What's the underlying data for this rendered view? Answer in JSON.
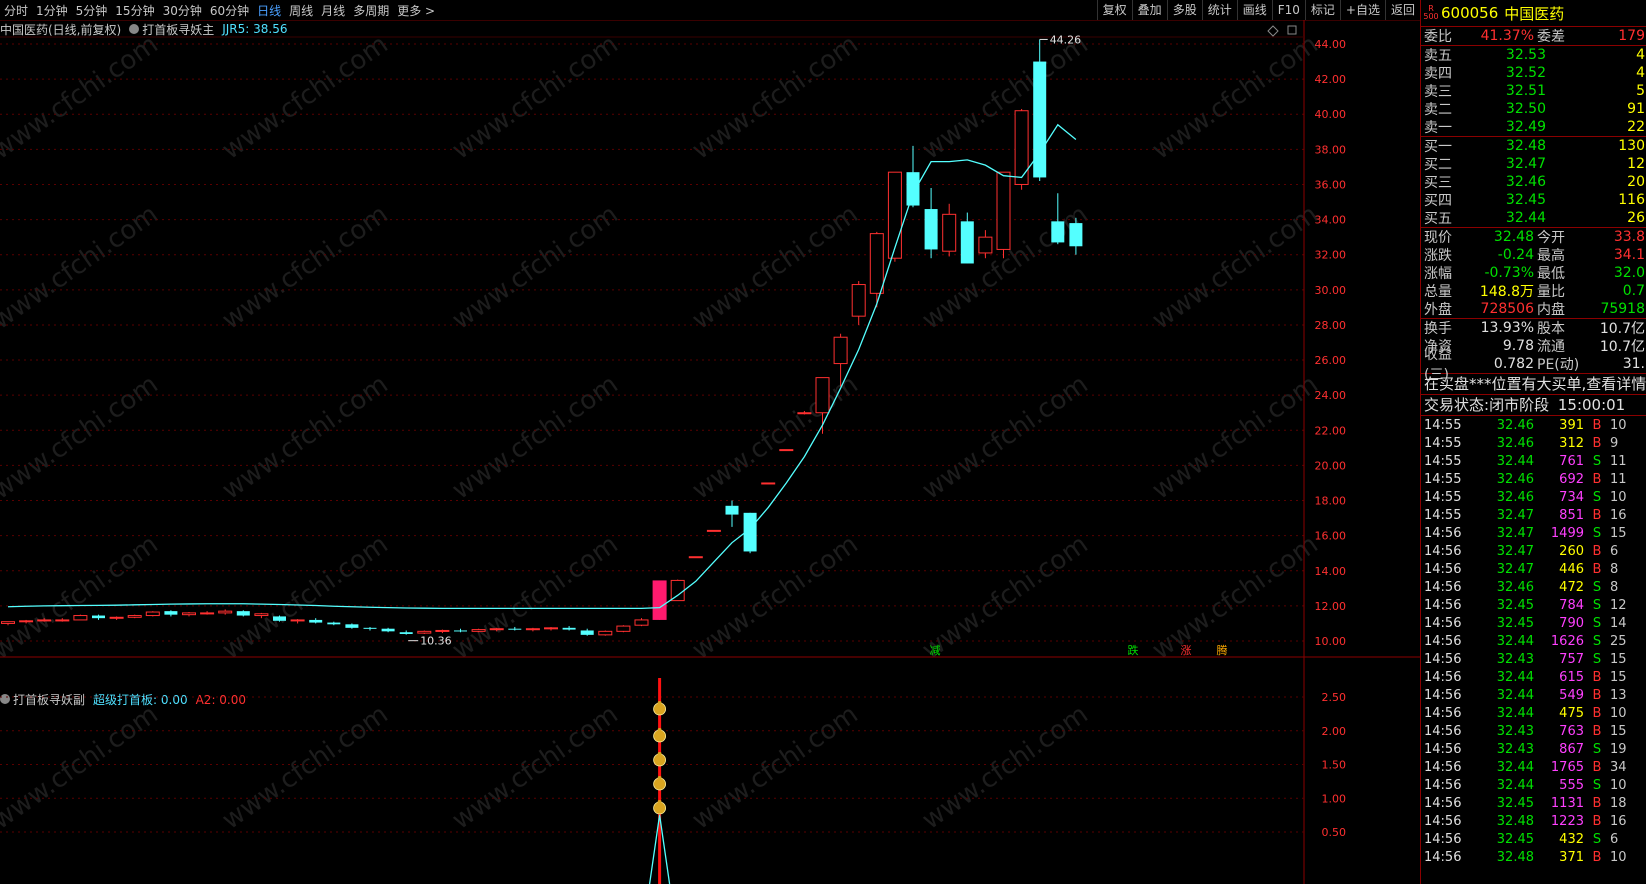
{
  "toolbar": {
    "periods": [
      "分时",
      "1分钟",
      "5分钟",
      "15分钟",
      "30分钟",
      "60分钟",
      "日线",
      "周线",
      "月线",
      "多周期",
      "更多 >"
    ],
    "active_period": "日线",
    "right_buttons": [
      "复权",
      "叠加",
      "多股",
      "统计",
      "画线",
      "F10",
      "标记",
      "+自选",
      "返回"
    ]
  },
  "main_header": {
    "stock_title": "中国医药(日线,前复权)",
    "indicator_name": "打首板寻妖主",
    "indicator_value": "JJR5: 38.56"
  },
  "sub_header": {
    "indicator_name": "打首板寻妖副",
    "value1": "超级打首板: 0.00",
    "value2": "A2: 0.00"
  },
  "price_axis": [
    "44.00",
    "42.00",
    "40.00",
    "38.00",
    "36.00",
    "34.00",
    "32.00",
    "30.00",
    "28.00",
    "26.00",
    "24.00",
    "22.00",
    "20.00",
    "18.00",
    "16.00",
    "14.00",
    "12.00",
    "10.00"
  ],
  "sub_axis": [
    "2.50",
    "2.00",
    "1.50",
    "1.00",
    "0.50"
  ],
  "chart_labels": {
    "high": "44.26",
    "low": "10.36"
  },
  "chart_markers": [
    "减",
    "跌",
    "涨",
    "腾"
  ],
  "watermark": "www.cfchi.com",
  "quote": {
    "badge_top": "R",
    "badge_bottom": "500",
    "code": "600056",
    "name": "中国医药",
    "weibi_label": "委比",
    "weibi": "41.37%",
    "weicha_label": "委差",
    "weicha": "179",
    "asks": [
      {
        "label": "卖五",
        "price": "32.53",
        "vol": "4"
      },
      {
        "label": "卖四",
        "price": "32.52",
        "vol": "4"
      },
      {
        "label": "卖三",
        "price": "32.51",
        "vol": "5"
      },
      {
        "label": "卖二",
        "price": "32.50",
        "vol": "91"
      },
      {
        "label": "卖一",
        "price": "32.49",
        "vol": "22"
      }
    ],
    "bids": [
      {
        "label": "买一",
        "price": "32.48",
        "vol": "130"
      },
      {
        "label": "买二",
        "price": "32.47",
        "vol": "12"
      },
      {
        "label": "买三",
        "price": "32.46",
        "vol": "20"
      },
      {
        "label": "买四",
        "price": "32.45",
        "vol": "116"
      },
      {
        "label": "买五",
        "price": "32.44",
        "vol": "26"
      }
    ],
    "stats1": [
      {
        "a": "现价",
        "b": "32.48",
        "bc": "g",
        "c": "今开",
        "d": "33.8",
        "dc": "r"
      },
      {
        "a": "涨跌",
        "b": "-0.24",
        "bc": "g",
        "c": "最高",
        "d": "34.1",
        "dc": "r"
      },
      {
        "a": "涨幅",
        "b": "-0.73%",
        "bc": "g",
        "c": "最低",
        "d": "32.0",
        "dc": "g"
      },
      {
        "a": "总量",
        "b": "148.8万",
        "bc": "y",
        "c": "量比",
        "d": "0.7",
        "dc": "g"
      },
      {
        "a": "外盘",
        "b": "728506",
        "bc": "r",
        "c": "内盘",
        "d": "75918",
        "dc": "g"
      }
    ],
    "stats2": [
      {
        "a": "换手",
        "b": "13.93%",
        "bc": "w",
        "c": "股本",
        "d": "10.7亿",
        "dc": "w"
      },
      {
        "a": "净资",
        "b": "9.78",
        "bc": "w",
        "c": "流通",
        "d": "10.7亿",
        "dc": "w"
      },
      {
        "a": "收益(三)",
        "b": "0.782",
        "bc": "w",
        "c": "PE(动)",
        "d": "31.",
        "dc": "w"
      }
    ],
    "notice": "在买盘***位置有大买单,查看详情",
    "trade_status_label": "交易状态:",
    "trade_status": "闭市阶段",
    "trade_time": "15:00:01"
  },
  "ticks": [
    {
      "t": "14:55",
      "p": "32.46",
      "v": "391",
      "vc": "y",
      "s": "B",
      "n": "10"
    },
    {
      "t": "14:55",
      "p": "32.46",
      "v": "312",
      "vc": "y",
      "s": "B",
      "n": "9"
    },
    {
      "t": "14:55",
      "p": "32.44",
      "v": "761",
      "vc": "m",
      "s": "S",
      "n": "11"
    },
    {
      "t": "14:55",
      "p": "32.46",
      "v": "692",
      "vc": "m",
      "s": "B",
      "n": "11"
    },
    {
      "t": "14:55",
      "p": "32.46",
      "v": "734",
      "vc": "m",
      "s": "S",
      "n": "10"
    },
    {
      "t": "14:55",
      "p": "32.47",
      "v": "851",
      "vc": "m",
      "s": "B",
      "n": "16"
    },
    {
      "t": "14:56",
      "p": "32.47",
      "v": "1499",
      "vc": "m",
      "s": "S",
      "n": "15"
    },
    {
      "t": "14:56",
      "p": "32.47",
      "v": "260",
      "vc": "y",
      "s": "B",
      "n": "6"
    },
    {
      "t": "14:56",
      "p": "32.47",
      "v": "446",
      "vc": "y",
      "s": "B",
      "n": "8"
    },
    {
      "t": "14:56",
      "p": "32.46",
      "v": "472",
      "vc": "y",
      "s": "S",
      "n": "8"
    },
    {
      "t": "14:56",
      "p": "32.45",
      "v": "784",
      "vc": "m",
      "s": "S",
      "n": "12"
    },
    {
      "t": "14:56",
      "p": "32.45",
      "v": "790",
      "vc": "m",
      "s": "S",
      "n": "14"
    },
    {
      "t": "14:56",
      "p": "32.44",
      "v": "1626",
      "vc": "m",
      "s": "S",
      "n": "25"
    },
    {
      "t": "14:56",
      "p": "32.43",
      "v": "757",
      "vc": "m",
      "s": "S",
      "n": "15"
    },
    {
      "t": "14:56",
      "p": "32.44",
      "v": "615",
      "vc": "m",
      "s": "B",
      "n": "15"
    },
    {
      "t": "14:56",
      "p": "32.44",
      "v": "549",
      "vc": "m",
      "s": "B",
      "n": "13"
    },
    {
      "t": "14:56",
      "p": "32.44",
      "v": "475",
      "vc": "y",
      "s": "B",
      "n": "10"
    },
    {
      "t": "14:56",
      "p": "32.43",
      "v": "763",
      "vc": "m",
      "s": "B",
      "n": "15"
    },
    {
      "t": "14:56",
      "p": "32.43",
      "v": "867",
      "vc": "m",
      "s": "S",
      "n": "19"
    },
    {
      "t": "14:56",
      "p": "32.44",
      "v": "1765",
      "vc": "m",
      "s": "B",
      "n": "34"
    },
    {
      "t": "14:56",
      "p": "32.44",
      "v": "555",
      "vc": "m",
      "s": "S",
      "n": "10"
    },
    {
      "t": "14:56",
      "p": "32.45",
      "v": "1131",
      "vc": "m",
      "s": "B",
      "n": "18"
    },
    {
      "t": "14:56",
      "p": "32.48",
      "v": "1223",
      "vc": "m",
      "s": "B",
      "n": "16"
    },
    {
      "t": "14:56",
      "p": "32.45",
      "v": "432",
      "vc": "y",
      "s": "S",
      "n": "6"
    },
    {
      "t": "14:56",
      "p": "32.48",
      "v": "371",
      "vc": "y",
      "s": "B",
      "n": "10"
    }
  ],
  "chart_data": {
    "type": "candlestick",
    "y_range": [
      10,
      44.5
    ],
    "candles": [
      [
        11.0,
        11.1,
        10.9,
        11.1
      ],
      [
        11.1,
        11.2,
        11.0,
        11.15
      ],
      [
        11.15,
        11.3,
        11.1,
        11.2
      ],
      [
        11.2,
        11.3,
        11.1,
        11.2
      ],
      [
        11.2,
        11.5,
        11.2,
        11.45
      ],
      [
        11.45,
        11.5,
        11.2,
        11.3
      ],
      [
        11.3,
        11.4,
        11.2,
        11.35
      ],
      [
        11.35,
        11.5,
        11.3,
        11.45
      ],
      [
        11.45,
        11.7,
        11.4,
        11.65
      ],
      [
        11.7,
        11.75,
        11.4,
        11.5
      ],
      [
        11.5,
        11.65,
        11.4,
        11.6
      ],
      [
        11.6,
        11.7,
        11.5,
        11.6
      ],
      [
        11.6,
        11.8,
        11.5,
        11.7
      ],
      [
        11.7,
        11.75,
        11.4,
        11.45
      ],
      [
        11.45,
        11.6,
        11.3,
        11.55
      ],
      [
        11.4,
        11.45,
        11.1,
        11.15
      ],
      [
        11.15,
        11.25,
        11.0,
        11.2
      ],
      [
        11.2,
        11.3,
        11.0,
        11.05
      ],
      [
        11.05,
        11.1,
        10.9,
        10.95
      ],
      [
        10.95,
        11.0,
        10.7,
        10.75
      ],
      [
        10.75,
        10.8,
        10.6,
        10.7
      ],
      [
        10.7,
        10.75,
        10.5,
        10.55
      ],
      [
        10.5,
        10.6,
        10.36,
        10.4
      ],
      [
        10.45,
        10.6,
        10.4,
        10.55
      ],
      [
        10.55,
        10.65,
        10.45,
        10.6
      ],
      [
        10.6,
        10.7,
        10.5,
        10.55
      ],
      [
        10.55,
        10.7,
        10.5,
        10.65
      ],
      [
        10.65,
        10.75,
        10.55,
        10.7
      ],
      [
        10.7,
        10.8,
        10.6,
        10.65
      ],
      [
        10.65,
        10.75,
        10.55,
        10.7
      ],
      [
        10.7,
        10.8,
        10.6,
        10.75
      ],
      [
        10.75,
        10.85,
        10.6,
        10.65
      ],
      [
        10.6,
        10.7,
        10.3,
        10.35
      ],
      [
        10.35,
        10.6,
        10.3,
        10.55
      ],
      [
        10.55,
        10.9,
        10.5,
        10.85
      ],
      [
        10.9,
        11.3,
        10.85,
        11.2
      ],
      [
        11.2,
        12.3,
        11.2,
        12.3
      ],
      [
        12.3,
        13.5,
        12.3,
        13.45
      ],
      [
        14.8,
        14.8,
        14.8,
        14.8
      ],
      [
        16.3,
        16.3,
        16.3,
        16.3
      ],
      [
        17.7,
        18.0,
        16.5,
        17.2
      ],
      [
        17.3,
        17.3,
        15.0,
        15.1
      ],
      [
        19.0,
        19.0,
        19.0,
        19.0
      ],
      [
        20.9,
        20.9,
        20.9,
        20.9
      ],
      [
        23.0,
        23.1,
        22.9,
        23.0
      ],
      [
        23.0,
        25.0,
        21.8,
        25.0
      ],
      [
        25.8,
        27.5,
        24.5,
        27.3
      ],
      [
        28.5,
        30.5,
        28.0,
        30.3
      ],
      [
        29.8,
        33.3,
        29.0,
        33.2
      ],
      [
        31.8,
        36.7,
        31.6,
        36.7
      ],
      [
        36.7,
        38.2,
        34.7,
        34.8
      ],
      [
        34.6,
        35.8,
        31.8,
        32.3
      ],
      [
        32.2,
        34.9,
        31.9,
        34.3
      ],
      [
        33.9,
        34.4,
        31.5,
        31.5
      ],
      [
        32.1,
        33.4,
        31.8,
        33.0
      ],
      [
        32.3,
        36.7,
        31.8,
        36.7
      ],
      [
        36.0,
        40.3,
        35.7,
        40.2
      ],
      [
        43.0,
        44.26,
        36.2,
        36.4
      ],
      [
        33.9,
        35.5,
        32.6,
        32.7
      ],
      [
        33.8,
        34.1,
        32.0,
        32.48
      ]
    ],
    "ma": [
      11.95,
      11.98,
      12.0,
      12.01,
      12.02,
      12.03,
      12.04,
      12.06,
      12.08,
      12.1,
      12.11,
      12.12,
      12.12,
      12.12,
      12.1,
      12.08,
      12.05,
      12.02,
      11.98,
      11.95,
      11.92,
      11.9,
      11.88,
      11.87,
      11.86,
      11.86,
      11.86,
      11.86,
      11.86,
      11.86,
      11.86,
      11.86,
      11.86,
      11.86,
      11.86,
      11.86,
      11.9,
      12.6,
      13.4,
      14.5,
      15.6,
      16.4,
      17.6,
      19.0,
      20.5,
      22.3,
      24.4,
      26.6,
      29.2,
      32.4,
      35.5,
      37.3,
      37.3,
      37.4,
      37.1,
      36.5,
      36.4,
      37.8,
      39.4,
      38.56
    ],
    "sub_series": {
      "x_index": 36,
      "values": [
        0,
        0,
        0
      ]
    }
  }
}
